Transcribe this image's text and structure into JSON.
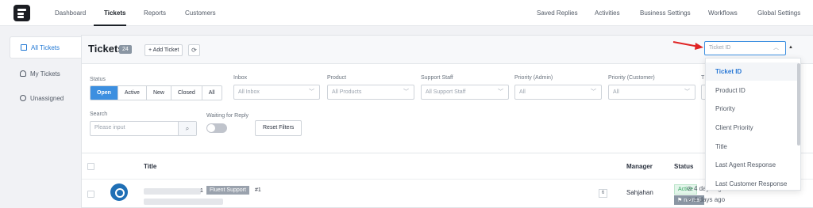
{
  "nav": {
    "left": [
      "Dashboard",
      "Tickets",
      "Reports",
      "Customers"
    ],
    "right": [
      "Saved Replies",
      "Activities",
      "Business Settings",
      "Workflows",
      "Global Settings"
    ]
  },
  "sidebar": {
    "items": [
      "All Tickets",
      "My Tickets",
      "Unassigned"
    ]
  },
  "header": {
    "title": "Tickets",
    "count": "24",
    "add_label": "+ Add Ticket",
    "refresh_icon": "⟳",
    "sort_placeholder": "Ticket ID",
    "sort_dir": "▲"
  },
  "filters": {
    "status_label": "Status",
    "status_options": [
      "Open",
      "Active",
      "New",
      "Closed",
      "All"
    ],
    "inbox_label": "Inbox",
    "inbox_value": "All Inbox",
    "product_label": "Product",
    "product_value": "All Products",
    "staff_label": "Support Staff",
    "staff_value": "All Support Staff",
    "prio_admin_label": "Priority (Admin)",
    "prio_admin_value": "All",
    "prio_customer_label": "Priority (Customer)",
    "prio_customer_value": "All",
    "extra_label": "T",
    "search_label": "Search",
    "search_placeholder": "Please input",
    "waiting_label": "Waiting for Reply",
    "reset_label": "Reset Filters"
  },
  "table": {
    "headers": {
      "title": "Title",
      "manager": "Manager",
      "status": "Status"
    },
    "row": {
      "ticket_prefix": "1",
      "product": "Fluent Support",
      "number": "#1",
      "responses": "6",
      "manager": "Sahjahan",
      "status": "Active",
      "priority": "normal",
      "ago_1": "4 days ago",
      "ago_2": "4 days ago"
    }
  },
  "sort_dropdown": {
    "options": [
      "Ticket ID",
      "Product ID",
      "Priority",
      "Client Priority",
      "Title",
      "Last Agent Response",
      "Last Customer Response"
    ]
  },
  "colors": {
    "accent": "#3c8fe0",
    "annotation": "#e02424"
  }
}
